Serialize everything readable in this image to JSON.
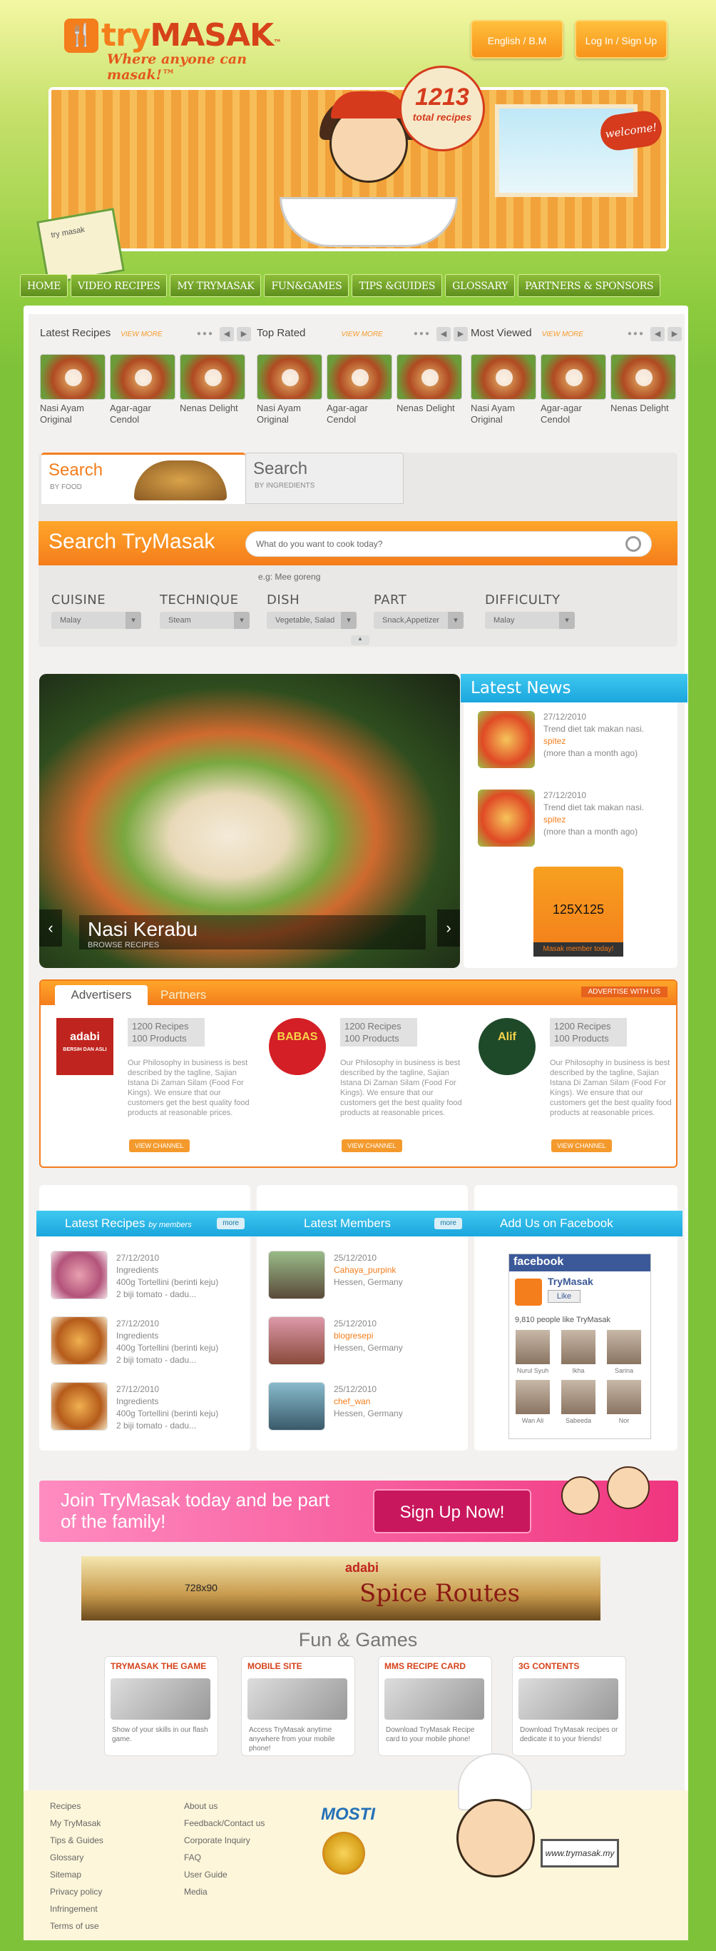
{
  "header": {
    "logo_prefix": "try",
    "logo_main": "MASAK",
    "logo_tm": "™",
    "tagline": "Where anyone can masak!™",
    "lang_button": "English / B.M",
    "login_button": "Log In / Sign Up"
  },
  "banner": {
    "recipe_count": "1213",
    "recipe_count_label": "total recipes",
    "welcome": "welcome!",
    "book_label": "try masak"
  },
  "nav": [
    "HOME",
    "VIDEO RECIPES",
    "MY TRYMASAK",
    "FUN&GAMES",
    "TIPS &GUIDES",
    "GLOSSARY",
    "PARTNERS & SPONSORS"
  ],
  "strips": [
    {
      "title": "Latest Recipes",
      "more": "VIEW MORE",
      "items": [
        "Nasi Ayam Original",
        "Agar-agar Cendol",
        "Nenas Delight"
      ]
    },
    {
      "title": "Top Rated",
      "more": "VIEW MORE",
      "items": [
        "Nasi Ayam Original",
        "Agar-agar Cendol",
        "Nenas Delight"
      ]
    },
    {
      "title": "Most Viewed",
      "more": "VIEW MORE",
      "items": [
        "Nasi Ayam Original",
        "Agar-agar Cendol",
        "Nenas Delight"
      ]
    }
  ],
  "search": {
    "tab1_title": "Search",
    "tab1_sub": "BY FOOD",
    "tab2_title": "Search",
    "tab2_sub": "BY INGREDIENTS",
    "bar_title": "Search TryMasak",
    "placeholder": "What do you want to cook today?",
    "example": "e.g: Mee goreng",
    "filters": [
      {
        "label": "CUISINE",
        "value": "Malay"
      },
      {
        "label": "TECHNIQUE",
        "value": "Steam"
      },
      {
        "label": "DISH",
        "value": "Vegetable, Salad"
      },
      {
        "label": "PART",
        "value": "Snack,Appetizer"
      },
      {
        "label": "DIFFICULTY",
        "value": "Malay"
      }
    ]
  },
  "hero": {
    "title": "Nasi Kerabu",
    "subtitle": "BROWSE RECIPES",
    "prev": "‹",
    "next": "›"
  },
  "news": {
    "title": "Latest News",
    "items": [
      {
        "date": "27/12/2010",
        "text": "Trend diet tak makan nasi.",
        "author": "spitez",
        "ago": "(more than a month ago)"
      },
      {
        "date": "27/12/2010",
        "text": "Trend diet tak makan nasi.",
        "author": "spitez",
        "ago": "(more than a month ago)"
      }
    ],
    "ad_size": "125X125",
    "ad_text": "Masak member today!"
  },
  "advertisers": {
    "tab1": "Advertisers",
    "tab2": "Partners",
    "advertise": "ADVERTISE WITH US",
    "brands": [
      {
        "name": "adabi",
        "sub": "BERSIH DAN ASLI",
        "recipes": "1200 Recipes",
        "products": "100 Products",
        "desc": "Our Philosophy in business is best described by the tagline, Sajian Istana Di Zaman Silam (Food For Kings). We ensure that our customers get the best quality food products at reasonable prices.",
        "cta": "VIEW CHANNEL"
      },
      {
        "name": "BABAS",
        "sub": "",
        "recipes": "1200 Recipes",
        "products": "100 Products",
        "desc": "Our Philosophy in business is best described by the tagline, Sajian Istana Di Zaman Silam (Food For Kings). We ensure that our customers get the best quality food products at reasonable prices.",
        "cta": "VIEW CHANNEL"
      },
      {
        "name": "Alif",
        "sub": "",
        "recipes": "1200 Recipes",
        "products": "100 Products",
        "desc": "Our Philosophy in business is best described by the tagline, Sajian Istana Di Zaman Silam (Food For Kings). We ensure that our customers get the best quality food products at reasonable prices.",
        "cta": "VIEW CHANNEL"
      }
    ]
  },
  "member_recipes": {
    "title": "Latest Recipes",
    "title_em": "by members",
    "more": "more",
    "items": [
      {
        "date": "27/12/2010",
        "l1": "Ingredients",
        "l2": "400g Tortellini (berinti keju)",
        "l3": "2 biji tomato - dadu..."
      },
      {
        "date": "27/12/2010",
        "l1": "Ingredients",
        "l2": "400g Tortellini (berinti keju)",
        "l3": "2 biji tomato - dadu..."
      },
      {
        "date": "27/12/2010",
        "l1": "Ingredients",
        "l2": "400g Tortellini (berinti keju)",
        "l3": "2 biji tomato - dadu..."
      }
    ]
  },
  "members": {
    "title": "Latest Members",
    "more": "more",
    "items": [
      {
        "date": "25/12/2010",
        "name": "Cahaya_purpink",
        "loc": "Hessen, Germany"
      },
      {
        "date": "25/12/2010",
        "name": "blogresepi",
        "loc": "Hessen, Germany"
      },
      {
        "date": "25/12/2010",
        "name": "chef_wan",
        "loc": "Hessen, Germany"
      }
    ]
  },
  "facebook": {
    "title": "Add Us on Facebook",
    "brand": "facebook",
    "page": "TryMasak",
    "like": "Like",
    "count": "9,810 people like TryMasak",
    "fans": [
      "Nurul Syuh",
      "Ikha",
      "Sarina",
      "Wan Ali",
      "Sabeeda",
      "Nor"
    ]
  },
  "join": {
    "text": "Join TryMasak today and be part of the family!",
    "button": "Sign Up Now!"
  },
  "ad728": {
    "size": "728x90",
    "brand": "adabi",
    "name": "Spice Routes"
  },
  "fun": {
    "title": "Fun & Games",
    "cards": [
      {
        "title": "TRYMASAK THE GAME",
        "desc": "Show of your skills in our flash game."
      },
      {
        "title": "MOBILE SITE",
        "desc": "Access TryMasak anytime anywhere from your mobile phone!"
      },
      {
        "title": "MMS RECIPE CARD",
        "desc": "Download TryMasak Recipe card to your mobile phone!"
      },
      {
        "title": "3G CONTENTS",
        "desc": "Download TryMasak recipes or dedicate it to your friends!"
      }
    ]
  },
  "footer": {
    "col1": [
      "Recipes",
      "My TryMasak",
      "Tips & Guides",
      "Glossary",
      "Sitemap",
      "Privacy policy",
      "Infringement",
      "Terms of use"
    ],
    "col2": [
      "About us",
      "Feedback/Contact us",
      "Corporate Inquiry",
      "FAQ",
      "User Guide",
      "Media"
    ],
    "mosti": "MOSTI",
    "url": "www.trymasak.my"
  }
}
